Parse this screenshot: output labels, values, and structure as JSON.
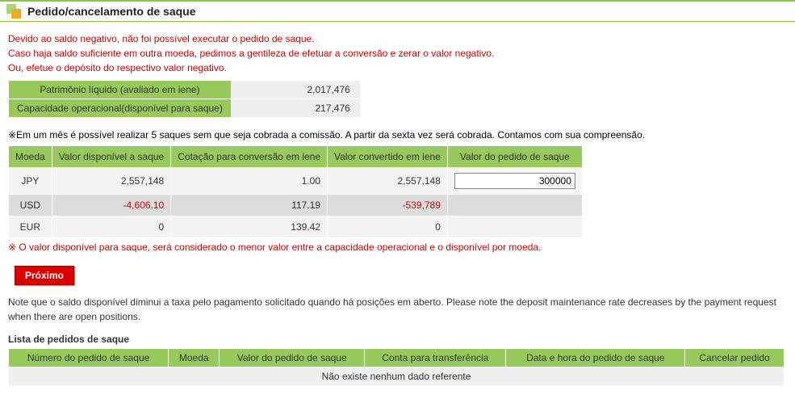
{
  "header": {
    "title": "Pedido/cancelamento de saque"
  },
  "warning": {
    "line1": "Devido ao saldo negativo, não foi possível executar o pedido de saque.",
    "line2": "Caso haja saldo suficiente em outra moeda, pedimos a gentileza de efetuar a conversão e zerar o valor negativo.",
    "line3": "Ou, efetue o depósito do respectivo valor negativo."
  },
  "summary": {
    "equity_label": "Patrimônio líquido (avaliado em iene)",
    "equity_value": "2,017,476",
    "capacity_label": "Capacidade operacional(disponível para saque)",
    "capacity_value": "217,476"
  },
  "note_commission": "※Em um mês é possível realizar 5 saques sem que seja cobrada a comissão. A partir da sexta vez será cobrada. Contamos com sua compreensão.",
  "balance_headers": {
    "currency": "Moeda",
    "available": "Valor disponível a saque",
    "rate": "Cotação para conversão em iene",
    "converted": "Valor convertido em iene",
    "request": "Valor do pedido de saque"
  },
  "balance_rows": {
    "jpy": {
      "cur": "JPY",
      "available": "2,557,148",
      "rate": "1.00",
      "converted": "2,557,148",
      "request_value": "300000"
    },
    "usd": {
      "cur": "USD",
      "available": "-4,606.10",
      "rate": "117.19",
      "converted": "-539,789"
    },
    "eur": {
      "cur": "EUR",
      "available": "0",
      "rate": "139.42",
      "converted": "0"
    }
  },
  "note_limit": "※ O valor disponível para saque, será considerado o menor valor entre a capacidade operacional e o disponível por moeda.",
  "buttons": {
    "next": "Próximo"
  },
  "paragraph_note": "Note que o saldo disponível diminui a taxa pelo pagamento solicitado quando há posições em aberto. Please note the deposit maintenance rate decreases by the payment request when there are open positions.",
  "requests": {
    "title": "Lista de pedidos de saque",
    "headers": {
      "number": "Número do pedido de saque",
      "currency": "Moeda",
      "amount": "Valor do pedido de saque",
      "account": "Conta para transferência",
      "datetime": "Data e hora do pedido de saque",
      "cancel": "Cancelar pedido"
    },
    "empty": "Não existe nenhum dado referente"
  }
}
